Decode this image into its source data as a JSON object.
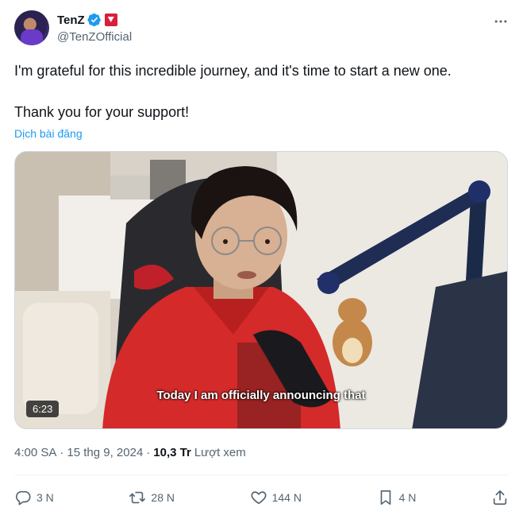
{
  "author": {
    "display_name": "TenZ",
    "handle": "@TenZOfficial",
    "verified_color": "#1d9bf0",
    "affiliate_badge_color": "#d81f3a"
  },
  "tweet": {
    "line1": "I'm grateful for this incredible journey, and it's time to start a new one.",
    "line2": "Thank you for your support!",
    "translate_label": "Dịch bài đăng"
  },
  "media": {
    "duration": "6:23",
    "caption": "Today I am officially announcing that"
  },
  "meta": {
    "time": "4:00 SA",
    "date": "15 thg 9, 2024",
    "views_count": "10,3 Tr",
    "views_label": "Lượt xem"
  },
  "actions": {
    "reply_count": "3 N",
    "retweet_count": "28 N",
    "like_count": "144 N",
    "bookmark_count": "4 N"
  },
  "icons": {
    "more": "more-horizontal-icon",
    "reply": "reply-icon",
    "retweet": "retweet-icon",
    "like": "heart-icon",
    "bookmark": "bookmark-icon",
    "share": "share-icon"
  }
}
